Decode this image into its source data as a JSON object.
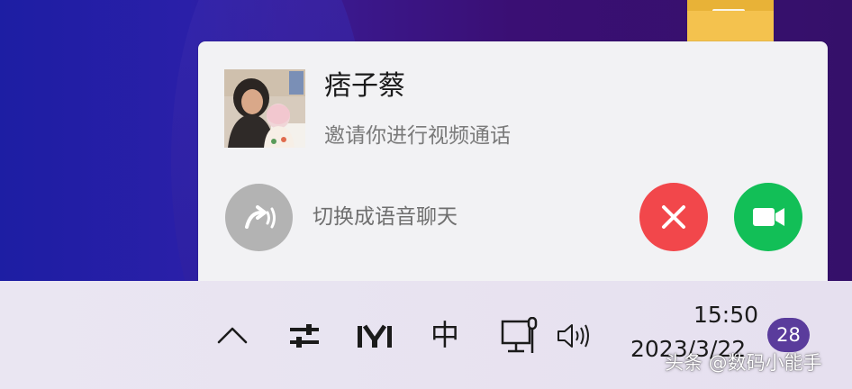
{
  "notification": {
    "caller_name": "痞子蔡",
    "description": "邀请你进行视频通话",
    "switch_label": "切换成语音聊天",
    "colors": {
      "decline": "#f2474b",
      "accept": "#12bf57",
      "switch": "#b3b3b3"
    },
    "icons": {
      "avatar": "caller-photo",
      "switch": "voice-switch-icon",
      "decline": "close-x-icon",
      "accept": "video-camera-icon"
    }
  },
  "desktop": {
    "icon": "folder-icon"
  },
  "taskbar": {
    "icons": [
      "chevron-up-icon",
      "sliders-icon",
      "m-logo-icon",
      "input-method-icon",
      "monitor-icon",
      "speaker-icon"
    ],
    "ime_label": "中",
    "time": "15:50",
    "date": "2023/3/22",
    "notification_count": "28",
    "badge_color": "#5a3c9c"
  },
  "watermark": "头条 @数码小能手"
}
